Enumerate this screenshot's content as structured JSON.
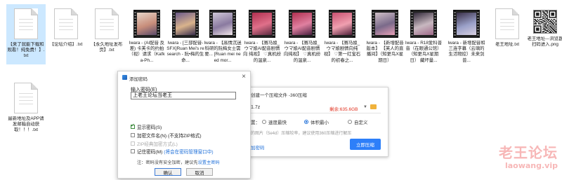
{
  "files": [
    {
      "kind": "doc",
      "name": "【来了就能下载和观看！纯免费！】.txt",
      "selected": true
    },
    {
      "kind": "doc",
      "name": "【论坛介绍】.txt",
      "selected": false
    },
    {
      "kind": "doc",
      "name": "【永久地址发布页】.txt",
      "selected": false
    },
    {
      "kind": "video",
      "name": "Iwara - (AI配音 反差) 卡芙卡的约拍（视）请求（Kafka-Ph...",
      "selected": false
    },
    {
      "kind": "video",
      "name": "Iwara - [三部配音-SFX]Ruan Mei's research - 阮•梅的生命...",
      "selected": false
    },
    {
      "kind": "video",
      "name": "Iwara - 【高情沉迷科研的阮梅女士需要... [Ruan mei need mor...",
      "selected": false
    },
    {
      "kind": "video",
      "name": "Iwara - 【赛马娘_ウマ娘AI配音剧情向 纯视】 ♡真机纷的温泉...",
      "selected": false
    },
    {
      "kind": "video",
      "name": "Iwara - 【赛马娘_ウマ娘AI配音剧情向纯视】 ♡真机纷的温泉...",
      "selected": false
    },
    {
      "kind": "video",
      "name": "Iwara - 【赛马娘_ウマ娘剧情向纯视】 ♡第一红宝石的初春之...",
      "selected": false
    },
    {
      "kind": "video",
      "name": "Iwara - 【新增配音版本】 【芙人的直播间】（知更鸟X星期日）",
      "selected": false
    },
    {
      "kind": "video",
      "name": "Iwara - R18爱科普音（在眼通公馆）（知更鸟X星期日） 藏坏量...",
      "selected": false
    },
    {
      "kind": "video",
      "name": "Iwara - 新增配音和三连字幕（云璃的生活物挖）未来剑普...",
      "selected": false
    },
    {
      "kind": "doc",
      "name": "老王地址.txt",
      "selected": false
    },
    {
      "kind": "qr",
      "name": "老王地址---浏览器扫码进入.png",
      "selected": false
    },
    {
      "kind": "doc",
      "name": "最新地址及APP请发邮箱自动获取！！！.txt",
      "selected": false
    }
  ],
  "zip_dialog": {
    "title": "创建一个压缩文件 -360压缩",
    "filename": "1.7z",
    "free_space": "剩余:635.6GB",
    "dropdown": "▼",
    "method_label": "置：",
    "options": [
      "速度最快",
      "体积最小",
      "自定义"
    ],
    "selected_option": 1,
    "hint": "的图片（5e4d）压缩较率，建议使用360压缩进行解压",
    "password_link": "加密码",
    "start_button": "立即压缩"
  },
  "password_dialog": {
    "title": "添加密码",
    "close": "×",
    "input_label": "输入密码(E)",
    "input_value": "上老王论坛当老王",
    "checkboxes": [
      {
        "label": "显示密码(S)",
        "checked": true,
        "disabled": false,
        "link": ""
      },
      {
        "label": "加密文件名(N) (不支持ZIP格式)",
        "checked": false,
        "disabled": false,
        "link": ""
      },
      {
        "label": "ZIP经典加密方式(L)",
        "checked": false,
        "disabled": true,
        "link": ""
      },
      {
        "label": "记住密码(M)",
        "checked": false,
        "disabled": false,
        "link": "(将会在密码管理窗口中)"
      }
    ],
    "note_prefix": "注：密码没有安全加密，建议先",
    "note_link": "设置主密码",
    "ok": "确认",
    "cancel": "取消"
  },
  "watermark": {
    "line1": "老王论坛",
    "line2": "laowang.vip"
  },
  "colors": {
    "selection": "#cce8ff",
    "link": "#1e6fd9",
    "primary_button": "#2d7ff9",
    "watermark": "#f7b7b7"
  }
}
